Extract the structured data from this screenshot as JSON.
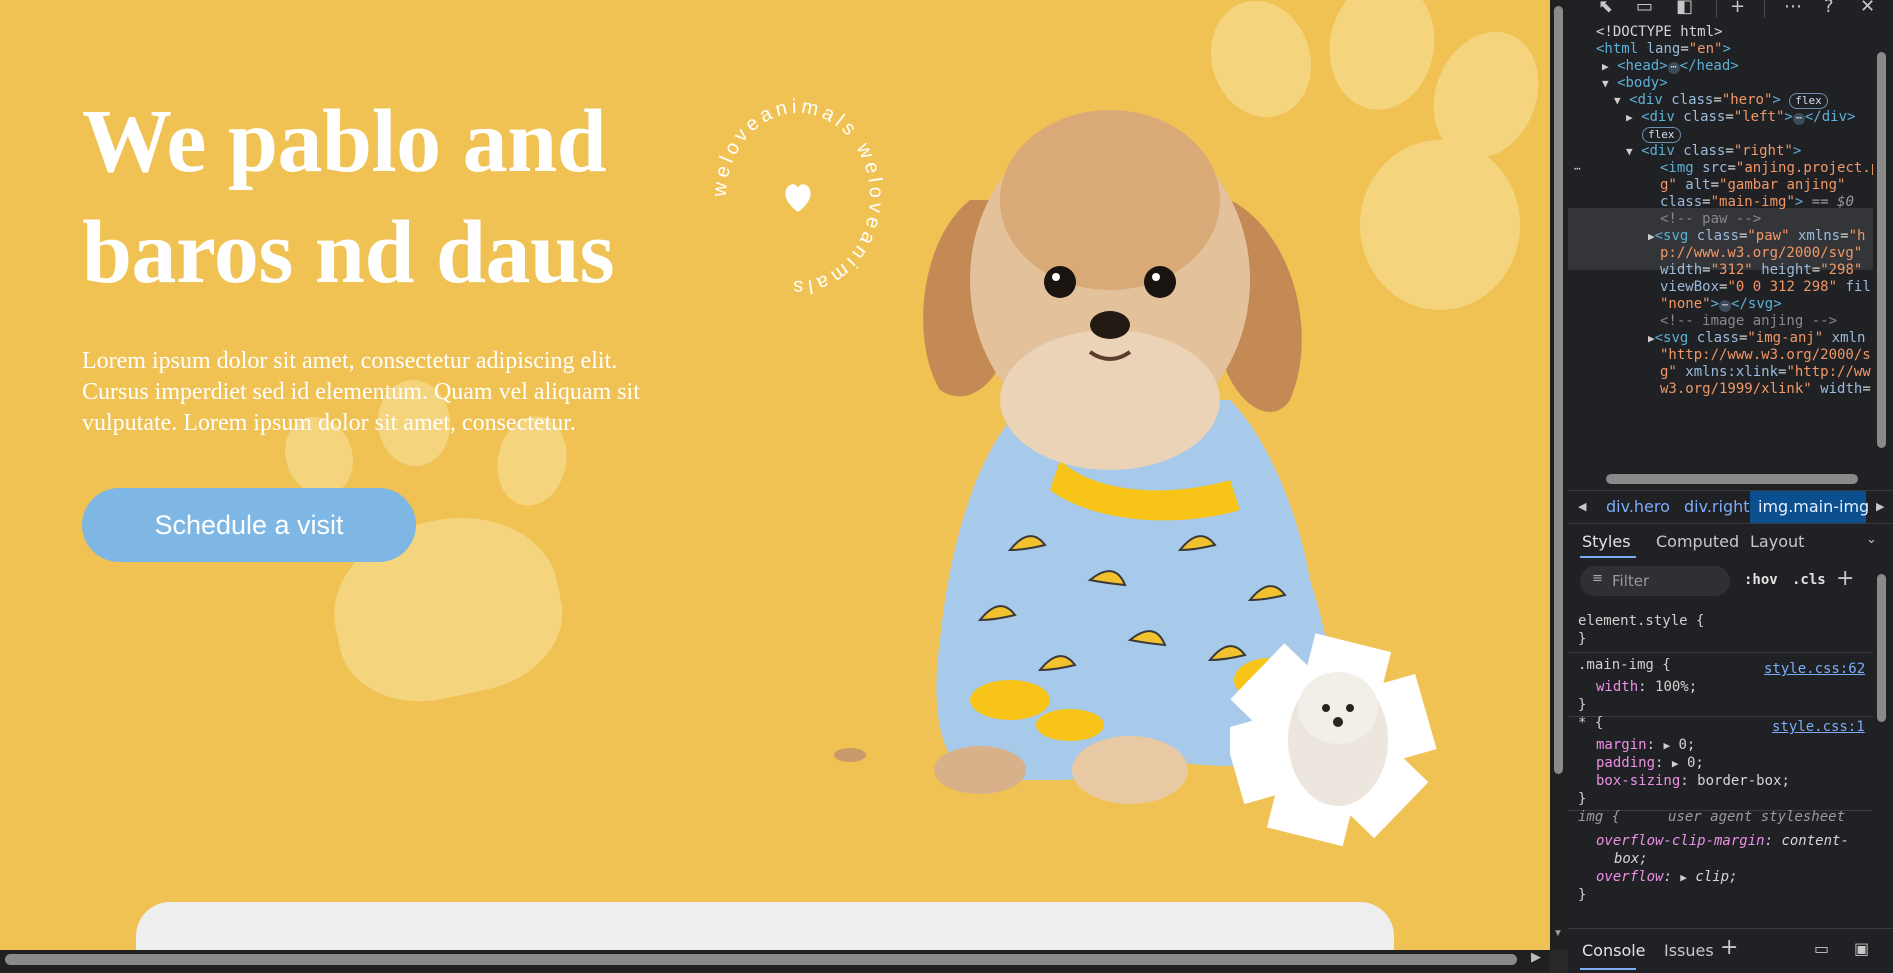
{
  "page": {
    "hero_title_line1": "We pablo and",
    "hero_title_line2": "baros nd daus",
    "description_line1": "Lorem ipsum dolor sit amet, consectetur adipiscing elit.",
    "description_line2": "Cursus imperdiet sed id elementum. Quam vel aliquam sit",
    "description_line3": "vulputate. Lorem ipsum dolor sit amet, consectetur.",
    "cta_label": "Schedule a visit",
    "badge_text": "weloveanimals weloveanimals",
    "colors": {
      "background": "#F0C254",
      "cta": "#7EB6E4",
      "paw": "#F5D47E",
      "card": "#EEEEEE"
    }
  },
  "devtools": {
    "dom": {
      "doctype": "<!DOCTYPE html>",
      "html_open": "<html",
      "html_lang_attr": "lang",
      "html_lang_val": "\"en\"",
      "html_close": ">",
      "head_open": "<head>",
      "head_close": "</head>",
      "body_open": "<body>",
      "hero_open": "<div",
      "hero_class_attr": "class",
      "hero_class_val": "\"hero\"",
      "tag_close": ">",
      "flex_badge": "flex",
      "left_open": "<div",
      "left_class_attr": "class",
      "left_class_val": "\"left\"",
      "div_end": "</div>",
      "right_open": "<div",
      "right_class_attr": "class",
      "right_class_val": "\"right\"",
      "img_open": "<img",
      "img_src_attr": "src",
      "img_src_val": "\"anjing.project.p",
      "img_src_val2": "g\"",
      "img_alt_attr": "alt",
      "img_alt_val": "\"gambar anjing\"",
      "img_class_attr": "class",
      "img_class_val": "\"main-img\"",
      "eq_dollar": "== $0",
      "comment_paw": "<!-- paw -->",
      "svg_open": "<svg",
      "svg_class_attr": "class",
      "svg_class_val": "\"paw\"",
      "svg_xmlns_attr": "xmlns",
      "svg_xmlns_val1": "\"h",
      "svg_xmlns_val2": "p://www.w3.org/2000/svg\"",
      "svg_width_attr": "width",
      "svg_width_val": "\"312\"",
      "svg_height_attr": "height",
      "svg_height_val": "\"298\"",
      "svg_viewbox_attr": "viewBox",
      "svg_viewbox_val": "\"0 0 312 298\"",
      "svg_fill_attr": "fil",
      "svg_fill_val": "\"none\"",
      "svg_close": "</svg>",
      "comment_img": "<!-- image anjing -->",
      "svg2_class_val": "\"img-anj\"",
      "svg2_xmlns_attr": "xmln",
      "svg2_xmlns_val": "\"http://www.w3.org/2000/s",
      "svg2_xlink_val1": "g\"",
      "svg2_xlink_attr": "xmlns:xlink",
      "svg2_xlink_val2": "\"http://ww",
      "svg2_xlink_val3": "w3.org/1999/xlink\"",
      "svg2_width_attr": "width"
    },
    "breadcrumbs": [
      "div.hero",
      "div.right",
      "img.main-img"
    ],
    "tabs": [
      "Styles",
      "Computed",
      "Layout"
    ],
    "filter_placeholder": "Filter",
    "hov": ":hov",
    "cls": ".cls",
    "styles": {
      "element_style": "element.style {",
      "close_brace": "}",
      "main_img_selector": ".main-img {",
      "main_img_link": "style.css:62",
      "width_prop": "width",
      "width_val": "100%;",
      "star_selector": "* {",
      "star_link": "style.css:1",
      "margin_prop": "margin",
      "margin_val": "0;",
      "padding_prop": "padding",
      "padding_val": "0;",
      "boxsizing_prop": "box-sizing",
      "boxsizing_val": "border-box;",
      "img_selector": "img {",
      "ua_label": "user agent stylesheet",
      "ocm_prop": "overflow-clip-margin",
      "ocm_val1": "content-",
      "ocm_val2": "box;",
      "overflow_prop": "overflow",
      "overflow_val": "clip;"
    },
    "drawer": {
      "console": "Console",
      "issues": "Issues"
    }
  }
}
